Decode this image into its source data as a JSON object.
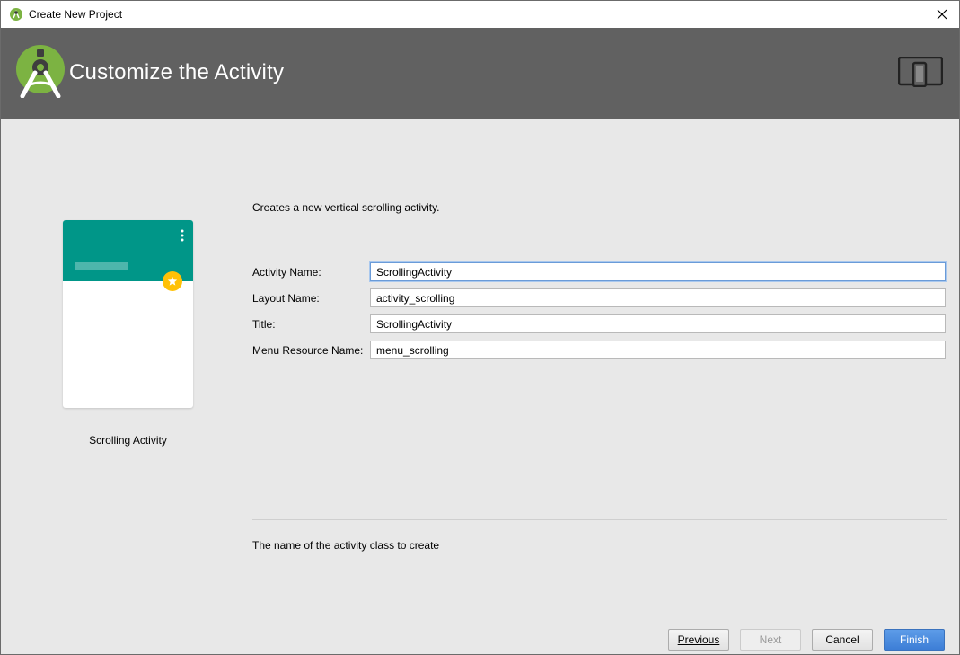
{
  "window": {
    "title": "Create New Project"
  },
  "banner": {
    "heading": "Customize the Activity",
    "logo_icon": "android-studio-logo-icon",
    "device_icon": "tablet-phone-icon"
  },
  "preview": {
    "label": "Scrolling Activity",
    "colors": {
      "appbar": "#009688",
      "fab": "#ffc107"
    }
  },
  "form": {
    "description": "Creates a new vertical scrolling activity.",
    "fields": [
      {
        "label": "Activity Name:",
        "value": "ScrollingActivity"
      },
      {
        "label": "Layout Name:",
        "value": "activity_scrolling"
      },
      {
        "label": "Title:",
        "value": "ScrollingActivity"
      },
      {
        "label": "Menu Resource Name:",
        "value": "menu_scrolling"
      }
    ],
    "help_text": "The name of the activity class to create"
  },
  "buttons": {
    "previous": "Previous",
    "next": "Next",
    "cancel": "Cancel",
    "finish": "Finish"
  },
  "colors": {
    "banner_bg": "#616161",
    "primary_button": "#3d7ed6"
  }
}
